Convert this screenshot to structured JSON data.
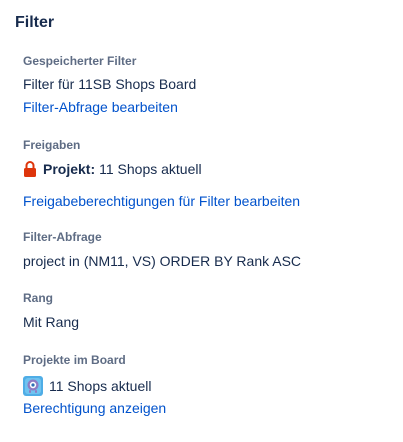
{
  "panel": {
    "title": "Filter"
  },
  "saved_filter": {
    "label": "Gespeicherter Filter",
    "name": "Filter für 11SB Shops Board",
    "edit_link": "Filter-Abfrage bearbeiten"
  },
  "shares": {
    "label": "Freigaben",
    "icon": "lock-icon",
    "icon_color": "#de350b",
    "project_prefix": "Projekt:",
    "project_name": "11 Shops aktuell",
    "edit_link": "Freigabeberechtigungen für Filter bearbeiten"
  },
  "filter_query": {
    "label": "Filter-Abfrage",
    "query": "project in (NM11, VS) ORDER BY Rank ASC"
  },
  "rank": {
    "label": "Rang",
    "value": "Mit Rang"
  },
  "board_projects": {
    "label": "Projekte im Board",
    "icon": "project-avatar-icon",
    "project_name": "11 Shops aktuell",
    "permissions_link": "Berechtigung anzeigen"
  },
  "colors": {
    "text": "#172b4d",
    "label": "#5e6c84",
    "link": "#0052cc"
  }
}
